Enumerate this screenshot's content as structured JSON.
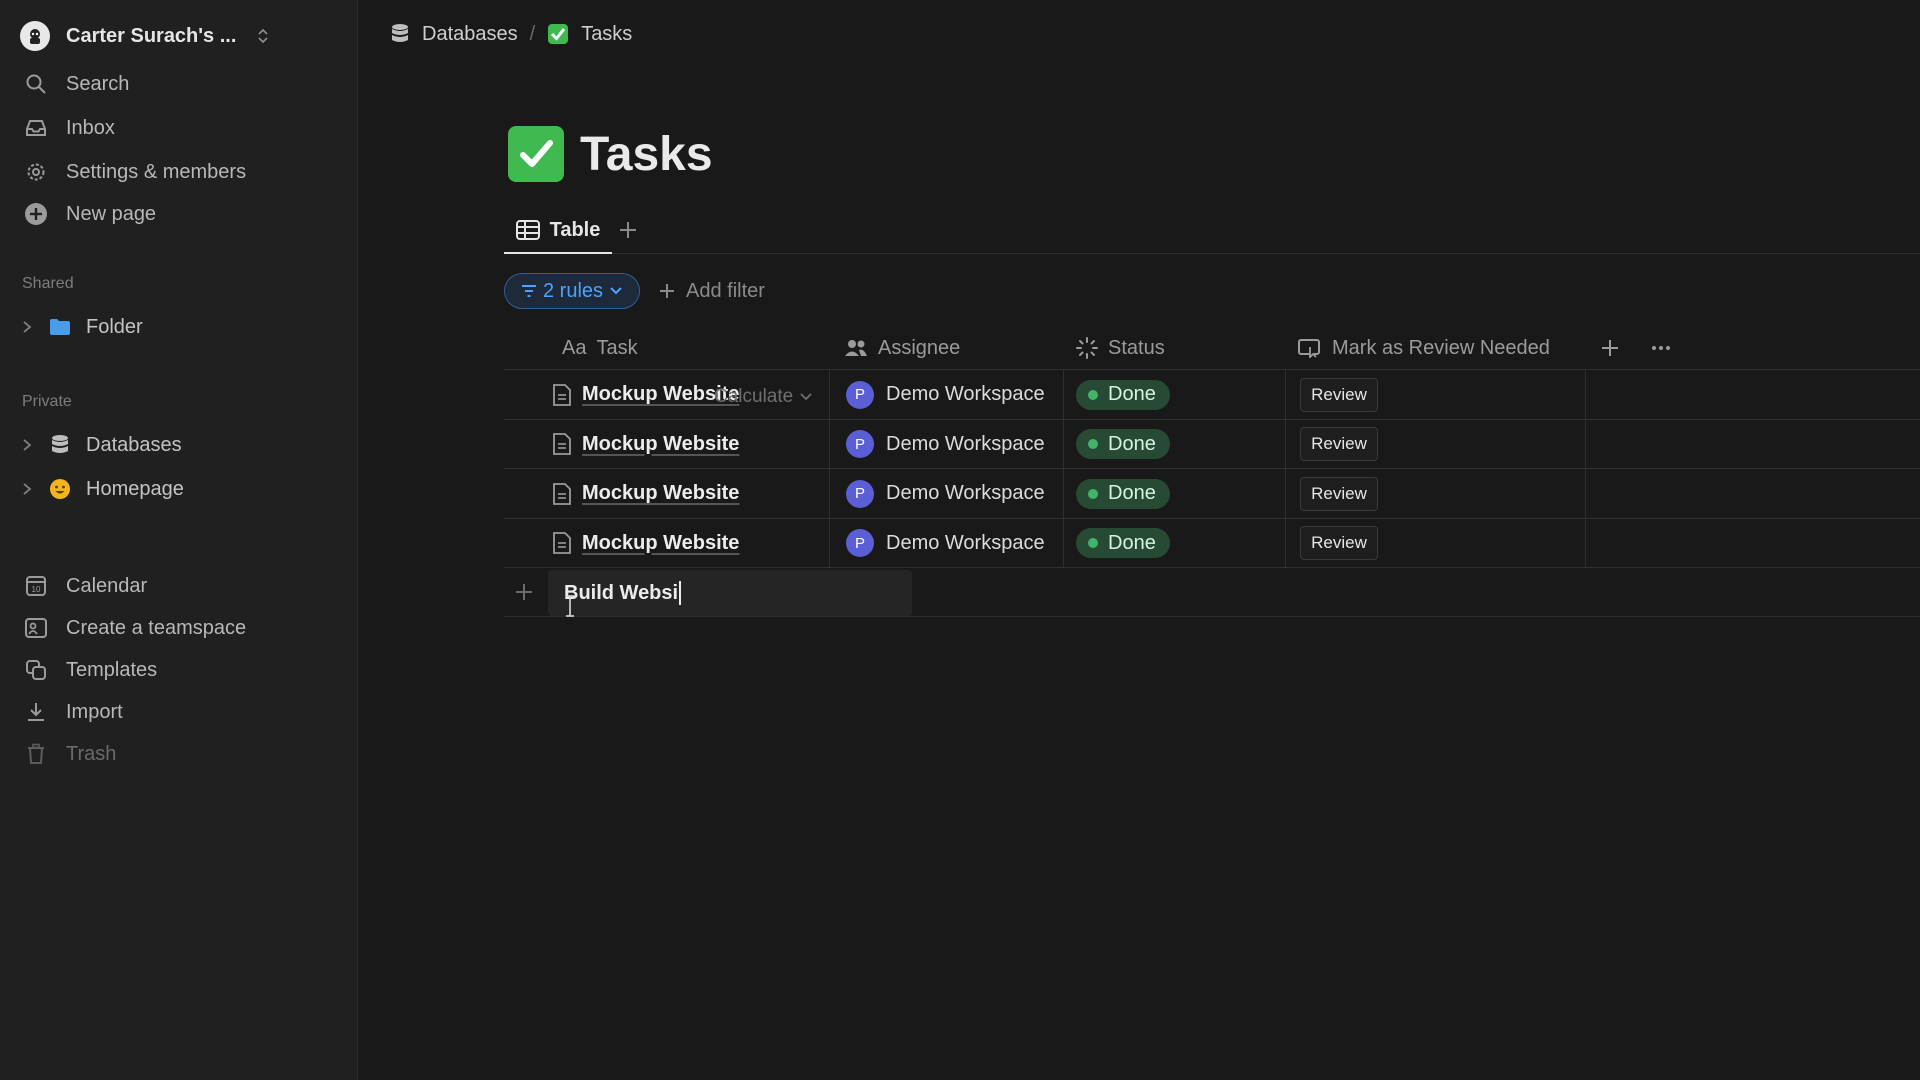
{
  "sidebar": {
    "workspace_name": "Carter Surach's ...",
    "nav": [
      {
        "label": "Search",
        "icon": "search-icon"
      },
      {
        "label": "Inbox",
        "icon": "inbox-icon"
      },
      {
        "label": "Settings & members",
        "icon": "gear-icon"
      },
      {
        "label": "New page",
        "icon": "plus-circle-icon"
      }
    ],
    "shared_label": "Shared",
    "shared_items": [
      {
        "label": "Folder",
        "icon": "folder-icon"
      }
    ],
    "private_label": "Private",
    "private_items": [
      {
        "label": "Databases",
        "icon": "database-icon"
      },
      {
        "label": "Homepage",
        "icon": "smiley-icon"
      }
    ],
    "bottom": [
      {
        "label": "Calendar",
        "icon": "calendar-icon"
      },
      {
        "label": "Create a teamspace",
        "icon": "teamspace-icon"
      },
      {
        "label": "Templates",
        "icon": "templates-icon"
      },
      {
        "label": "Import",
        "icon": "download-icon"
      },
      {
        "label": "Trash",
        "icon": "trash-icon"
      }
    ]
  },
  "breadcrumb": {
    "parent": "Databases",
    "separator": "/",
    "current": "Tasks"
  },
  "page": {
    "title": "Tasks"
  },
  "views": {
    "active": "Table"
  },
  "filters": {
    "rules_label": "2 rules",
    "add_filter": "Add filter"
  },
  "table": {
    "columns": {
      "task": {
        "label": "Task",
        "icon_text": "Aa"
      },
      "assignee": {
        "label": "Assignee"
      },
      "status": {
        "label": "Status"
      },
      "review": {
        "label": "Mark as Review Needed"
      }
    },
    "rows": [
      {
        "task": "Mockup Website",
        "avatar": "P",
        "assignee": "Demo Workspace",
        "status": "Done",
        "action": "Review"
      },
      {
        "task": "Mockup Website",
        "avatar": "P",
        "assignee": "Demo Workspace",
        "status": "Done",
        "action": "Review"
      },
      {
        "task": "Mockup Website",
        "avatar": "P",
        "assignee": "Demo Workspace",
        "status": "Done",
        "action": "Review"
      },
      {
        "task": "Mockup Website",
        "avatar": "P",
        "assignee": "Demo Workspace",
        "status": "Done",
        "action": "Review"
      }
    ],
    "new_row_value": "Build Websi",
    "calculate_label": "Calculate"
  },
  "colors": {
    "accent_blue": "#4aa3ff",
    "done_green": "#43b36a",
    "avatar_purple": "#5a5fd6",
    "check_green": "#3fb950"
  }
}
